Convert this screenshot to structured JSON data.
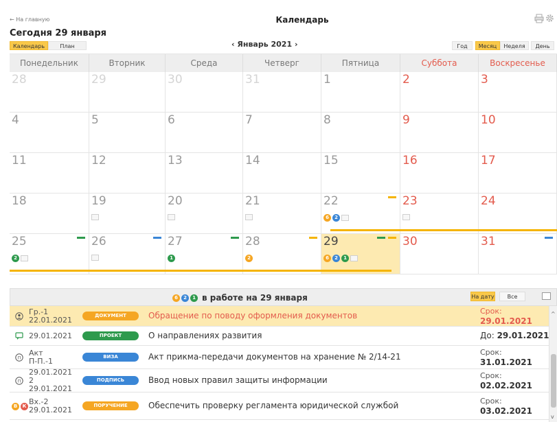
{
  "header": {
    "back_label": "← На главную",
    "title": "Календарь",
    "today_title": "Сегодня 29 января",
    "print_icon": "printer-icon",
    "settings_icon": "gear-icon"
  },
  "view_tabs": [
    "Календарь",
    "План"
  ],
  "month_nav": {
    "prev": "‹",
    "label": "Январь 2021",
    "next": "›"
  },
  "period_tabs": [
    "Год",
    "Месяц",
    "Неделя",
    "День"
  ],
  "weekdays": [
    "Понедельник",
    "Вторник",
    "Среда",
    "Четверг",
    "Пятница",
    "Суббота",
    "Воскресенье"
  ],
  "weeks": [
    [
      {
        "n": "28",
        "cur": false
      },
      {
        "n": "29",
        "cur": false
      },
      {
        "n": "30",
        "cur": false
      },
      {
        "n": "31",
        "cur": false
      },
      {
        "n": "1",
        "cur": true
      },
      {
        "n": "2",
        "cur": true
      },
      {
        "n": "3",
        "cur": true
      }
    ],
    [
      {
        "n": "4",
        "cur": true
      },
      {
        "n": "5",
        "cur": true
      },
      {
        "n": "6",
        "cur": true
      },
      {
        "n": "7",
        "cur": true
      },
      {
        "n": "8",
        "cur": true
      },
      {
        "n": "9",
        "cur": true
      },
      {
        "n": "10",
        "cur": true
      }
    ],
    [
      {
        "n": "11",
        "cur": true
      },
      {
        "n": "12",
        "cur": true
      },
      {
        "n": "13",
        "cur": true
      },
      {
        "n": "14",
        "cur": true
      },
      {
        "n": "15",
        "cur": true
      },
      {
        "n": "16",
        "cur": true
      },
      {
        "n": "17",
        "cur": true
      }
    ],
    [
      {
        "n": "18",
        "cur": true
      },
      {
        "n": "19",
        "cur": true,
        "mini": true
      },
      {
        "n": "20",
        "cur": true,
        "mini": true
      },
      {
        "n": "21",
        "cur": true,
        "mini": true
      },
      {
        "n": "22",
        "cur": true,
        "mini": true,
        "counts": [
          {
            "v": "6",
            "c": "#f5a623"
          },
          {
            "v": "2",
            "c": "#3a86d6"
          }
        ],
        "marks": [
          "#f5b400"
        ]
      },
      {
        "n": "23",
        "cur": true,
        "mini": true
      },
      {
        "n": "24",
        "cur": true
      }
    ],
    [
      {
        "n": "25",
        "cur": true,
        "mini": true,
        "counts": [
          {
            "v": "2",
            "c": "#2e9a4d"
          }
        ],
        "marks": [
          "#2e9a4d"
        ]
      },
      {
        "n": "26",
        "cur": true,
        "mini": true,
        "marks": [
          "#3a86d6"
        ]
      },
      {
        "n": "27",
        "cur": true,
        "counts": [
          {
            "v": "1",
            "c": "#2e9a4d"
          }
        ],
        "marks": [
          "#2e9a4d"
        ]
      },
      {
        "n": "28",
        "cur": true,
        "counts": [
          {
            "v": "2",
            "c": "#f5a623"
          }
        ],
        "marks": [
          "#f5b400"
        ]
      },
      {
        "n": "29",
        "cur": true,
        "today": true,
        "mini": true,
        "counts": [
          {
            "v": "6",
            "c": "#f5a623"
          },
          {
            "v": "2",
            "c": "#3a86d6"
          },
          {
            "v": "1",
            "c": "#2e9a4d"
          }
        ],
        "marks": [
          "#f5b400",
          "#2e9a4d"
        ]
      },
      {
        "n": "30",
        "cur": true
      },
      {
        "n": "31",
        "cur": true,
        "marks": [
          "#3a86d6"
        ]
      }
    ]
  ],
  "panel": {
    "counts": [
      {
        "v": "6",
        "c": "#f5a623"
      },
      {
        "v": "2",
        "c": "#3a86d6"
      },
      {
        "v": "1",
        "c": "#2e9a4d"
      }
    ],
    "title": "в работе на 29 января",
    "filters": [
      "На дату",
      "Все"
    ],
    "expand_icon": "expand-icon"
  },
  "rows": [
    {
      "icon": "person-icon",
      "ctx": "Гр.-1",
      "date": "22.01.2021",
      "tag": "ДОКУМЕНТ",
      "tag_color": "#f5a623",
      "subject": "Обращение по поводу оформления документов",
      "due_label": "Срок:",
      "due": "29.01.2021",
      "hl": true
    },
    {
      "icon": "chat-icon",
      "ctx": "",
      "date": "29.01.2021",
      "tag": "ПРОЕКТ",
      "tag_color": "#2e9a4d",
      "subject": "О направлениях развития",
      "due_inline_label": "До:",
      "due": "29.01.2021"
    },
    {
      "icon": "circle-p-icon",
      "ctx": "Акт",
      "ctx2": "П-П.-1",
      "date": "",
      "tag": "ВИЗА",
      "tag_color": "#3a86d6",
      "subject": "Акт прикма-передачи документов на хранение № 2/14-21",
      "due_label": "Срок:",
      "due": "31.01.2021"
    },
    {
      "icon": "circle-p-icon",
      "ctx": "29.01.2021",
      "ctx2": "2",
      "date": "29.01.2021",
      "tag": "ПОДПИСЬ",
      "tag_color": "#3a86d6",
      "subject": "Ввод новых правил защиты информации",
      "due_label": "Срок:",
      "due": "02.02.2021"
    },
    {
      "icon": "badge-icons",
      "badges": [
        {
          "v": "В",
          "c": "#f5a623"
        },
        {
          "v": "К",
          "c": "#e35b4d"
        }
      ],
      "ctx": "Вх.-2",
      "date": "29.01.2021",
      "tag": "ПОРУЧЕНИЕ",
      "tag_color": "#f5a623",
      "subject": "Обеспечить проверку регламента юридической службой",
      "due_label": "Срок:",
      "due": "03.02.2021"
    }
  ]
}
